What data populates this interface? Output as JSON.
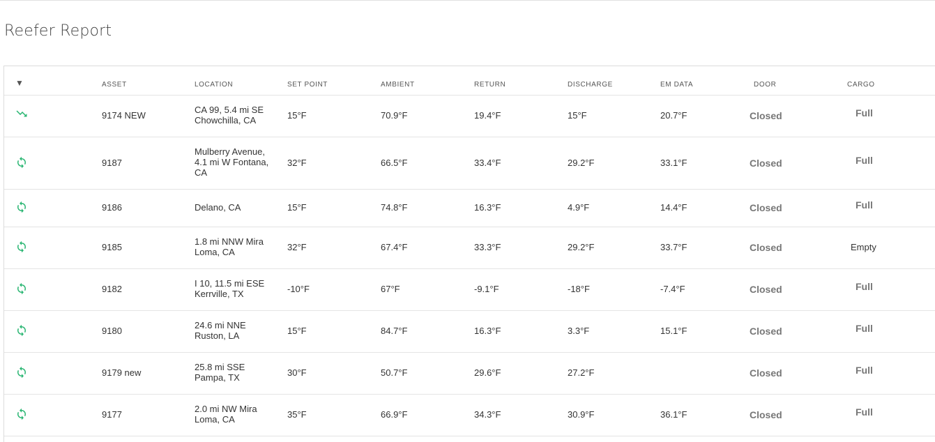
{
  "page": {
    "title": "Reefer Report"
  },
  "colors": {
    "accent": "#2bb673",
    "border": "#e4e4e4"
  },
  "table": {
    "sort_icon": "caret-down-icon",
    "columns": [
      "ASSET",
      "LOCATION",
      "SET POINT",
      "AMBIENT",
      "RETURN",
      "DISCHARGE",
      "EM DATA",
      "DOOR",
      "CARGO"
    ],
    "rows": [
      {
        "icon": "trending-down-icon",
        "asset": "9174 NEW",
        "location": [
          "CA 99, 5.4 mi SE",
          "Chowchilla, CA"
        ],
        "set_point": "15°F",
        "ambient": "70.9°F",
        "return": "19.4°F",
        "discharge": "15°F",
        "em_data": "20.7°F",
        "door": "Closed",
        "cargo": "Full"
      },
      {
        "icon": "sync-icon",
        "asset": "9187",
        "location": [
          "Mulberry Avenue,",
          "4.1 mi W Fontana,",
          "CA"
        ],
        "set_point": "32°F",
        "ambient": "66.5°F",
        "return": "33.4°F",
        "discharge": "29.2°F",
        "em_data": "33.1°F",
        "door": "Closed",
        "cargo": "Full"
      },
      {
        "icon": "sync-icon",
        "asset": "9186",
        "location": [
          "Delano, CA"
        ],
        "set_point": "15°F",
        "ambient": "74.8°F",
        "return": "16.3°F",
        "discharge": "4.9°F",
        "em_data": "14.4°F",
        "door": "Closed",
        "cargo": "Full"
      },
      {
        "icon": "sync-icon",
        "asset": "9185",
        "location": [
          "1.8 mi NNW Mira",
          "Loma, CA"
        ],
        "set_point": "32°F",
        "ambient": "67.4°F",
        "return": "33.3°F",
        "discharge": "29.2°F",
        "em_data": "33.7°F",
        "door": "Closed",
        "cargo": "Empty"
      },
      {
        "icon": "sync-icon",
        "asset": "9182",
        "location": [
          "I 10, 11.5 mi ESE",
          "Kerrville, TX"
        ],
        "set_point": "-10°F",
        "ambient": "67°F",
        "return": "-9.1°F",
        "discharge": "-18°F",
        "em_data": "-7.4°F",
        "door": "Closed",
        "cargo": "Full"
      },
      {
        "icon": "sync-icon",
        "asset": "9180",
        "location": [
          "24.6 mi NNE",
          "Ruston, LA"
        ],
        "set_point": "15°F",
        "ambient": "84.7°F",
        "return": "16.3°F",
        "discharge": "3.3°F",
        "em_data": "15.1°F",
        "door": "Closed",
        "cargo": "Full"
      },
      {
        "icon": "sync-icon",
        "asset": "9179 new",
        "location": [
          "25.8 mi SSE",
          "Pampa, TX"
        ],
        "set_point": "30°F",
        "ambient": "50.7°F",
        "return": "29.6°F",
        "discharge": "27.2°F",
        "em_data": "",
        "door": "Closed",
        "cargo": "Full"
      },
      {
        "icon": "sync-icon",
        "asset": "9177",
        "location": [
          "2.0 mi NW Mira",
          "Loma, CA"
        ],
        "set_point": "35°F",
        "ambient": "66.9°F",
        "return": "34.3°F",
        "discharge": "30.9°F",
        "em_data": "36.1°F",
        "door": "Closed",
        "cargo": "Full"
      }
    ]
  }
}
